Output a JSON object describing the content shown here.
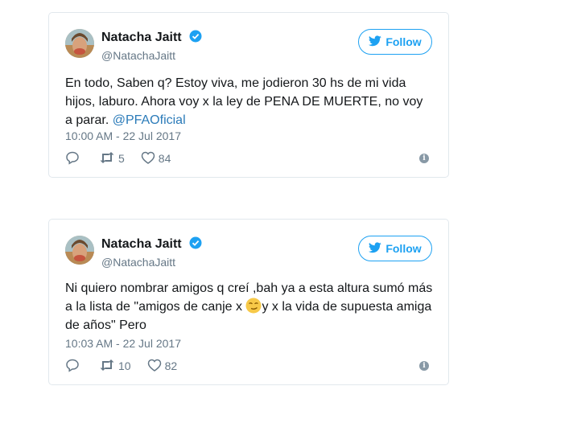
{
  "tweets": [
    {
      "name": "Natacha Jaitt",
      "handle": "@NatachaJaitt",
      "follow_label": "Follow",
      "text_lines": [
        "En todo, Saben q? Estoy viva, me jodieron 30 hs de mi vida",
        "hijos, laburo. Ahora voy x la ley de PENA DE MUERTE, no voy",
        "a parar. "
      ],
      "mention": "@PFAOficial",
      "timestamp": "10:00 AM - 22 Jul 2017",
      "reply_icon": "reply-icon",
      "retweets": "5",
      "likes": "84"
    },
    {
      "name": "Natacha Jaitt",
      "handle": "@NatachaJaitt",
      "follow_label": "Follow",
      "text_line1": "Ni quiero nombrar amigos q creí ,bah ya a esta altura sumó más",
      "text_line2a": "a la lista de \"amigos de canje x ",
      "text_line2b": "y x la vida de supuesta amiga",
      "text_line3": "de años\" Pero",
      "emoji_icon": "smirk-emoji-icon",
      "timestamp": "10:03 AM - 22 Jul 2017",
      "retweets": "10",
      "likes": "82"
    }
  ],
  "colors": {
    "accent": "#1da1f2",
    "link": "#2b7bb9",
    "muted": "#657786",
    "border": "#e1e8ed"
  },
  "info_glyph": "i"
}
